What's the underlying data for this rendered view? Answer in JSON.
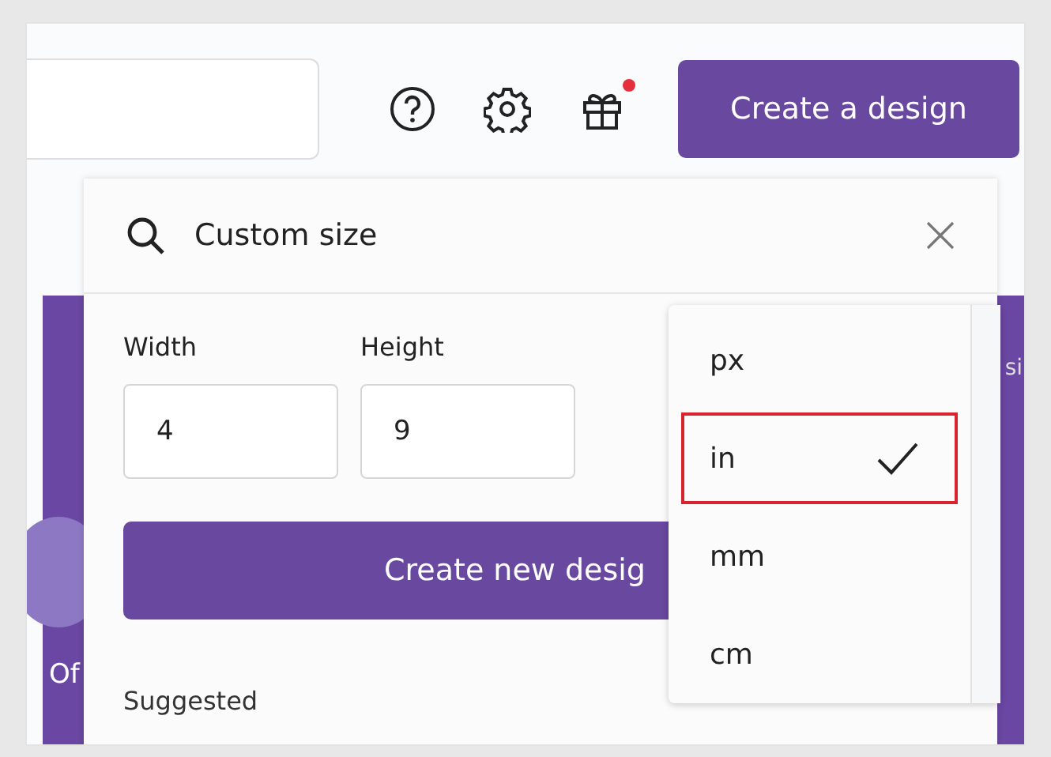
{
  "header": {
    "notification": true,
    "create_button": "Create a design"
  },
  "background": {
    "left_label": "Of",
    "right_label": "si"
  },
  "panel": {
    "search_value": "Custom size",
    "width": {
      "label": "Width",
      "value": "4"
    },
    "height": {
      "label": "Height",
      "value": "9"
    },
    "create_button": "Create new desig",
    "section_label": "Suggested"
  },
  "unit_menu": {
    "items": [
      {
        "label": "px",
        "selected": false,
        "highlighted": false
      },
      {
        "label": "in",
        "selected": true,
        "highlighted": true
      },
      {
        "label": "mm",
        "selected": false,
        "highlighted": false
      },
      {
        "label": "cm",
        "selected": false,
        "highlighted": false
      }
    ]
  }
}
